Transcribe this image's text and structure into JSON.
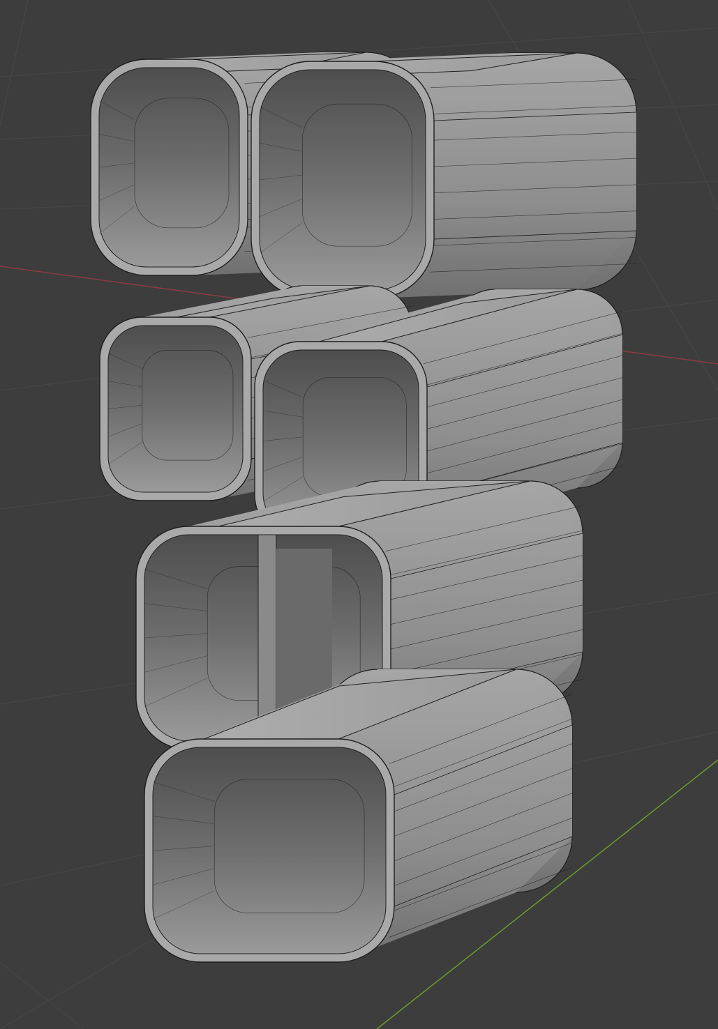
{
  "viewport": {
    "background_color": "#3d3d3d",
    "grid_color": "#474747",
    "x_axis_color": "#8a3a44",
    "y_axis_color": "#6e9a2c",
    "mesh_color": "#9c9c9c",
    "wire_color": "#1e1e1e"
  }
}
